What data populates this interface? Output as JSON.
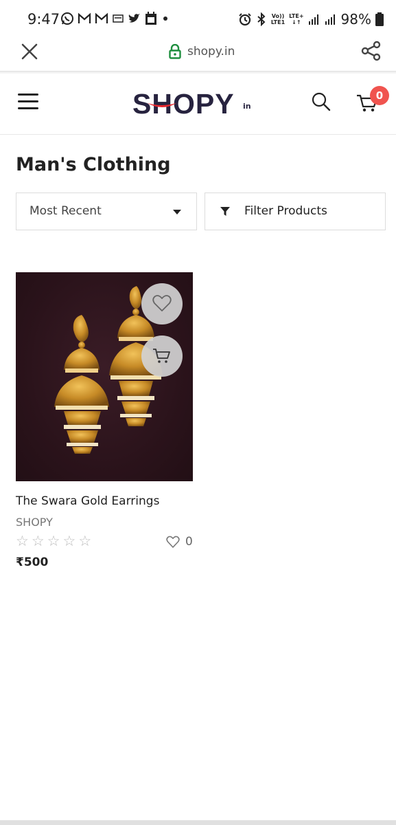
{
  "status_bar": {
    "time": "9:47",
    "left_icons": [
      "whatsapp-icon",
      "gmail-icon",
      "gmail-icon",
      "news-icon",
      "twitter-icon",
      "calendar-icon",
      "dot-icon"
    ],
    "volte": "Vo))",
    "lte1": "LTE1",
    "lte_plus": "LTE+",
    "battery": "98%"
  },
  "browser": {
    "url": "shopy.in"
  },
  "header": {
    "logo": "SHOPY",
    "logo_suffix": "in",
    "cart_count": "0"
  },
  "page": {
    "title": "Man's Clothing"
  },
  "controls": {
    "sort_label": "Most Recent",
    "filter_label": "Filter Products"
  },
  "products": [
    {
      "name": "The Swara Gold Earrings",
      "brand": "SHOPY",
      "rating": 0,
      "max_rating": 5,
      "likes": "0",
      "price": "₹500"
    }
  ],
  "colors": {
    "accent": "#f0544f",
    "brand_dark": "#27233f",
    "brand_red": "#e8262d",
    "lock_green": "#1e8e3e"
  }
}
